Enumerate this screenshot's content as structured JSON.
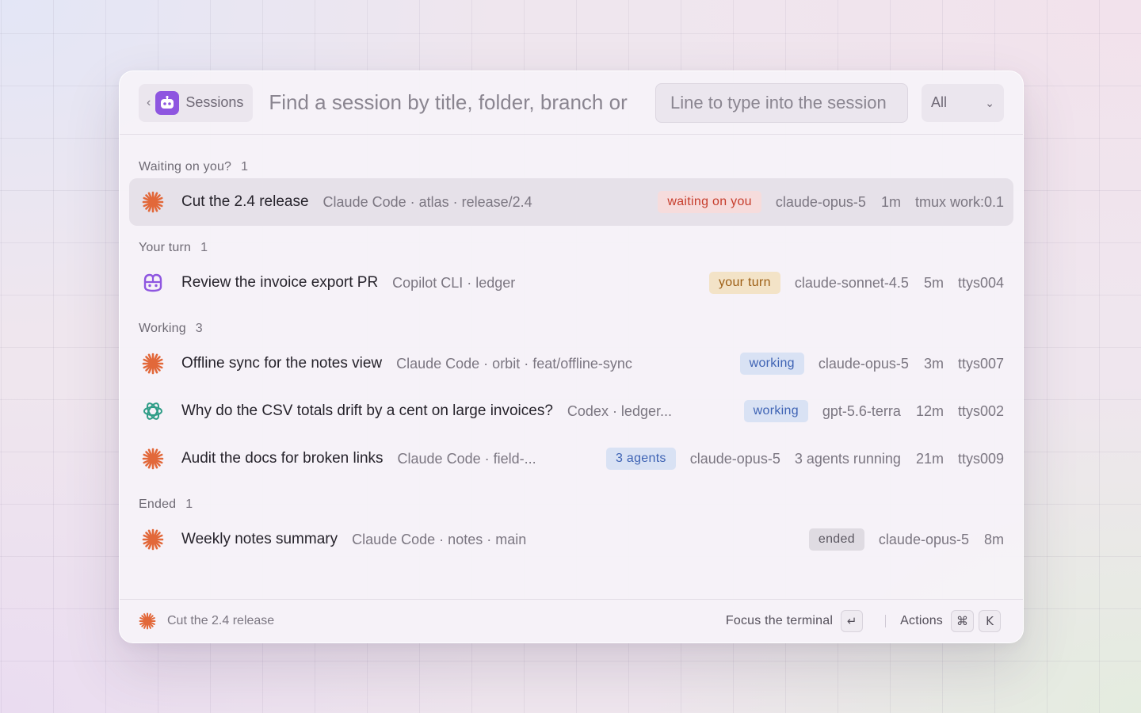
{
  "header": {
    "back_label": "Sessions",
    "search_placeholder": "Find a session by title, folder, branch or",
    "line_placeholder": "Line to type into the session",
    "filter_value": "All"
  },
  "colors": {
    "claude": "#e2683a",
    "copilot": "#8e56e0",
    "codex": "#2f9d87",
    "selected_row": "#e6e1e9"
  },
  "groups": {
    "waiting": {
      "label": "Waiting on you?",
      "count": "1",
      "rows": [
        {
          "icon": "claude-asterisk-icon",
          "title": "Cut the 2.4 release",
          "meta": "Claude Code · atlas · release/2.4",
          "badge": "waiting on you",
          "model": "claude-opus-5",
          "time": "1m",
          "tty": "tmux work:0.1"
        }
      ]
    },
    "yourturn": {
      "label": "Your turn",
      "count": "1",
      "rows": [
        {
          "icon": "copilot-icon",
          "title": "Review the invoice export PR",
          "meta": "Copilot CLI · ledger",
          "badge": "your turn",
          "model": "claude-sonnet-4.5",
          "time": "5m",
          "tty": "ttys004"
        }
      ]
    },
    "working": {
      "label": "Working",
      "count": "3",
      "rows": [
        {
          "icon": "claude-asterisk-icon",
          "title": "Offline sync for the notes view",
          "meta": "Claude Code · orbit · feat/offline-sync",
          "badge": "working",
          "model": "claude-opus-5",
          "time": "3m",
          "tty": "ttys007"
        },
        {
          "icon": "codex-icon",
          "title": "Why do the CSV totals drift by a cent on large invoices?",
          "meta": "Codex · ledger...",
          "badge": "working",
          "model": "gpt-5.6-terra",
          "time": "12m",
          "tty": "ttys002"
        },
        {
          "icon": "claude-asterisk-icon",
          "title": "Audit the docs for broken links",
          "meta": "Claude Code · field-...",
          "badge": "3 agents",
          "model": "claude-opus-5",
          "extra": "3 agents running",
          "time": "21m",
          "tty": "ttys009"
        }
      ]
    },
    "ended": {
      "label": "Ended",
      "count": "1",
      "rows": [
        {
          "icon": "claude-asterisk-icon",
          "title": "Weekly notes summary",
          "meta": "Claude Code · notes · main",
          "badge": "ended",
          "model": "claude-opus-5",
          "time": "8m"
        }
      ]
    }
  },
  "footer": {
    "selected_title": "Cut the 2.4 release",
    "focus_label": "Focus the terminal",
    "focus_key": "↵",
    "actions_label": "Actions",
    "actions_key_mod": "⌘",
    "actions_key": "K"
  }
}
